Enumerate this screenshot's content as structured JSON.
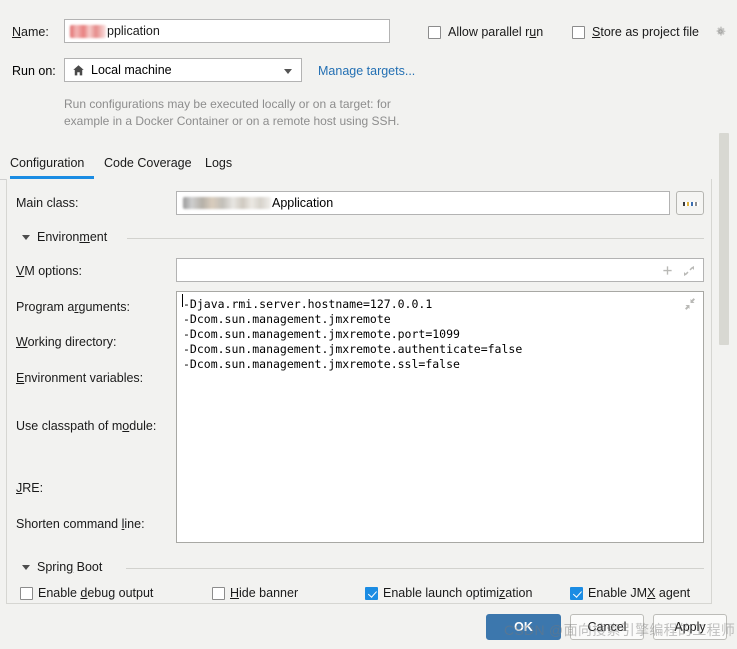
{
  "colors": {
    "accent_blue": "#1b8ce3",
    "link_blue": "#2470b3",
    "ok_button": "#3c77ad",
    "dialog_bg": "#f2f2f0",
    "field_border": "#b3b3b3"
  },
  "header": {
    "name_label": "Name:",
    "name_value_suffix": "pplication",
    "allow_parallel_run_label": "Allow parallel run",
    "allow_parallel_run_checked": false,
    "store_as_project_file_label": "Store as project file",
    "store_as_project_file_checked": false,
    "gear_icon": "gear-icon",
    "run_on_label": "Run on:",
    "run_on_value": "Local machine",
    "run_on_icon": "home-icon",
    "manage_targets_link": "Manage targets...",
    "hint_line1": "Run configurations may be executed locally or on a target: for",
    "hint_line2": "example in a Docker Container or on a remote host using SSH."
  },
  "tabs": [
    {
      "label": "Configuration",
      "active": true
    },
    {
      "label": "Code Coverage",
      "active": false
    },
    {
      "label": "Logs",
      "active": false
    }
  ],
  "form": {
    "main_class_label": "Main class:",
    "main_class_value_suffix": "Application",
    "browse_button_label": "...",
    "environment_section_title": "Environment",
    "vm_options_label": "VM options:",
    "vm_options_value": "",
    "vm_options_add_icon": "plus-icon",
    "vm_options_expand_icon": "expand-icon",
    "program_arguments_label": "Program arguments:",
    "program_arguments_value": "-Djava.rmi.server.hostname=127.0.0.1\n-Dcom.sun.management.jmxremote\n-Dcom.sun.management.jmxremote.port=1099\n-Dcom.sun.management.jmxremote.authenticate=false\n-Dcom.sun.management.jmxremote.ssl=false",
    "program_arguments_collapse_icon": "collapse-icon",
    "working_directory_label": "Working directory:",
    "environment_variables_label": "Environment variables:",
    "use_classpath_of_module_label": "Use classpath of module:",
    "jre_label": "JRE:",
    "shorten_command_line_label": "Shorten command line:"
  },
  "spring_boot": {
    "section_title": "Spring Boot",
    "options": [
      {
        "label": "Enable debug output",
        "checked": false
      },
      {
        "label": "Hide banner",
        "checked": false
      },
      {
        "label": "Enable launch optimization",
        "checked": true
      },
      {
        "label": "Enable JMX agent",
        "checked": true
      }
    ]
  },
  "buttons": {
    "ok": "OK",
    "cancel": "Cancel",
    "apply": "Apply"
  },
  "watermark": "CSDN @面向搜索引擎编程的工程师"
}
